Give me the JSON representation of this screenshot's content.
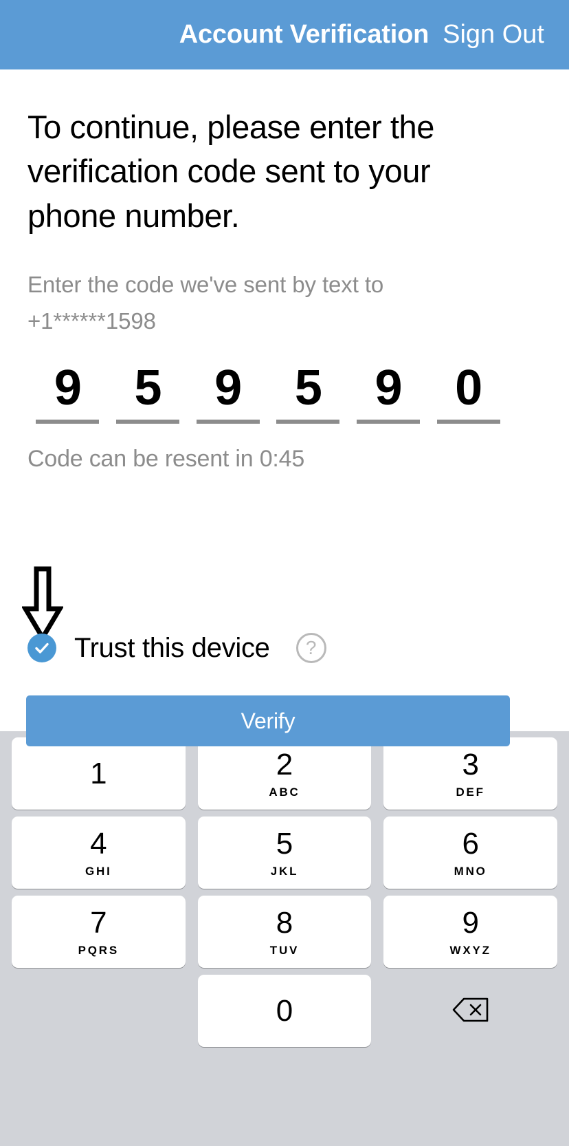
{
  "header": {
    "title": "Account Verification",
    "sign_out_label": "Sign Out",
    "background_color": "#5B9BD5",
    "text_color": "#FFFFFF"
  },
  "main": {
    "headline": "To continue, please enter the verification code sent to your phone number.",
    "subtitle": "Enter the code we've sent by text to +1******1598",
    "masked_phone": "+1******1598",
    "code_digits": [
      "9",
      "5",
      "9",
      "5",
      "9",
      "0"
    ],
    "resend_text": "Code can be resent in 0:45",
    "resend_timer": "0:45",
    "trust_device": {
      "label": "Trust this device",
      "checked": true,
      "check_glyph": "✓",
      "checkbox_color": "#4A98D4",
      "help_glyph": "?"
    },
    "verify_button_label": "Verify",
    "verify_button_color": "#5B9BD5"
  },
  "annotation": {
    "arrow_direction": "down",
    "arrow_target": "trust-this-device-checkbox"
  },
  "keypad": {
    "background_color": "#D1D3D8",
    "key_color": "#FFFFFF",
    "rows": [
      [
        {
          "num": "1",
          "letters": ""
        },
        {
          "num": "2",
          "letters": "ABC"
        },
        {
          "num": "3",
          "letters": "DEF"
        }
      ],
      [
        {
          "num": "4",
          "letters": "GHI"
        },
        {
          "num": "5",
          "letters": "JKL"
        },
        {
          "num": "6",
          "letters": "MNO"
        }
      ],
      [
        {
          "num": "7",
          "letters": "PQRS"
        },
        {
          "num": "8",
          "letters": "TUV"
        },
        {
          "num": "9",
          "letters": "WXYZ"
        }
      ],
      [
        {
          "num": "",
          "letters": "",
          "type": "blank"
        },
        {
          "num": "0",
          "letters": ""
        },
        {
          "num": "",
          "letters": "",
          "type": "backspace"
        }
      ]
    ]
  }
}
